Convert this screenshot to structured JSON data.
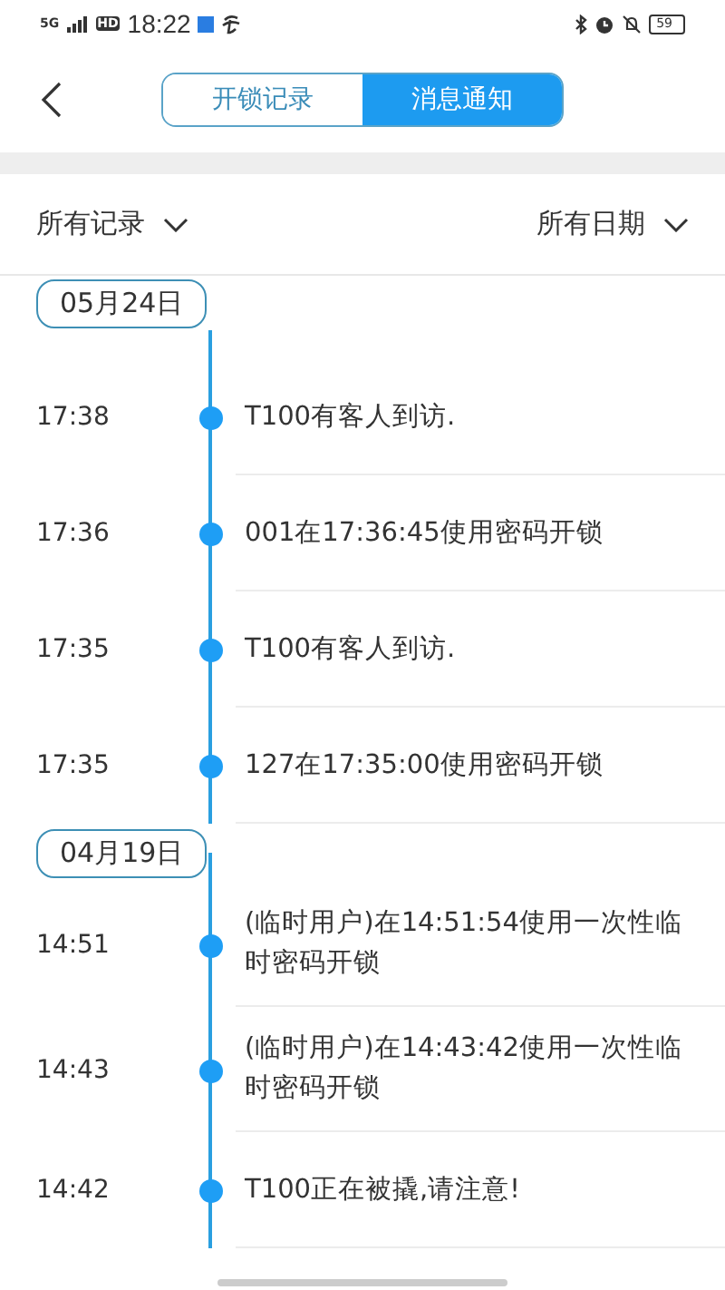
{
  "status_bar": {
    "network": "5G",
    "hd": "HD",
    "time": "18:22",
    "battery": "59"
  },
  "header": {
    "tabs": [
      {
        "label": "开锁记录",
        "selected": false
      },
      {
        "label": "消息通知",
        "selected": true
      }
    ]
  },
  "filters": [
    {
      "label": "所有记录"
    },
    {
      "label": "所有日期"
    }
  ],
  "groups": [
    {
      "date": "05月24日",
      "items": [
        {
          "time": "17:38",
          "text": "T100有客人到访."
        },
        {
          "time": "17:36",
          "text": "001在17:36:45使用密码开锁"
        },
        {
          "time": "17:35",
          "text": "T100有客人到访."
        },
        {
          "time": "17:35",
          "text": "127在17:35:00使用密码开锁"
        }
      ]
    },
    {
      "date": "04月19日",
      "items": [
        {
          "time": "14:51",
          "text": "(临时用户)在14:51:54使用一次性临时密码开锁"
        },
        {
          "time": "14:43",
          "text": "(临时用户)在14:43:42使用一次性临时密码开锁"
        },
        {
          "time": "14:42",
          "text": "T100正在被撬,请注意!"
        }
      ]
    }
  ]
}
